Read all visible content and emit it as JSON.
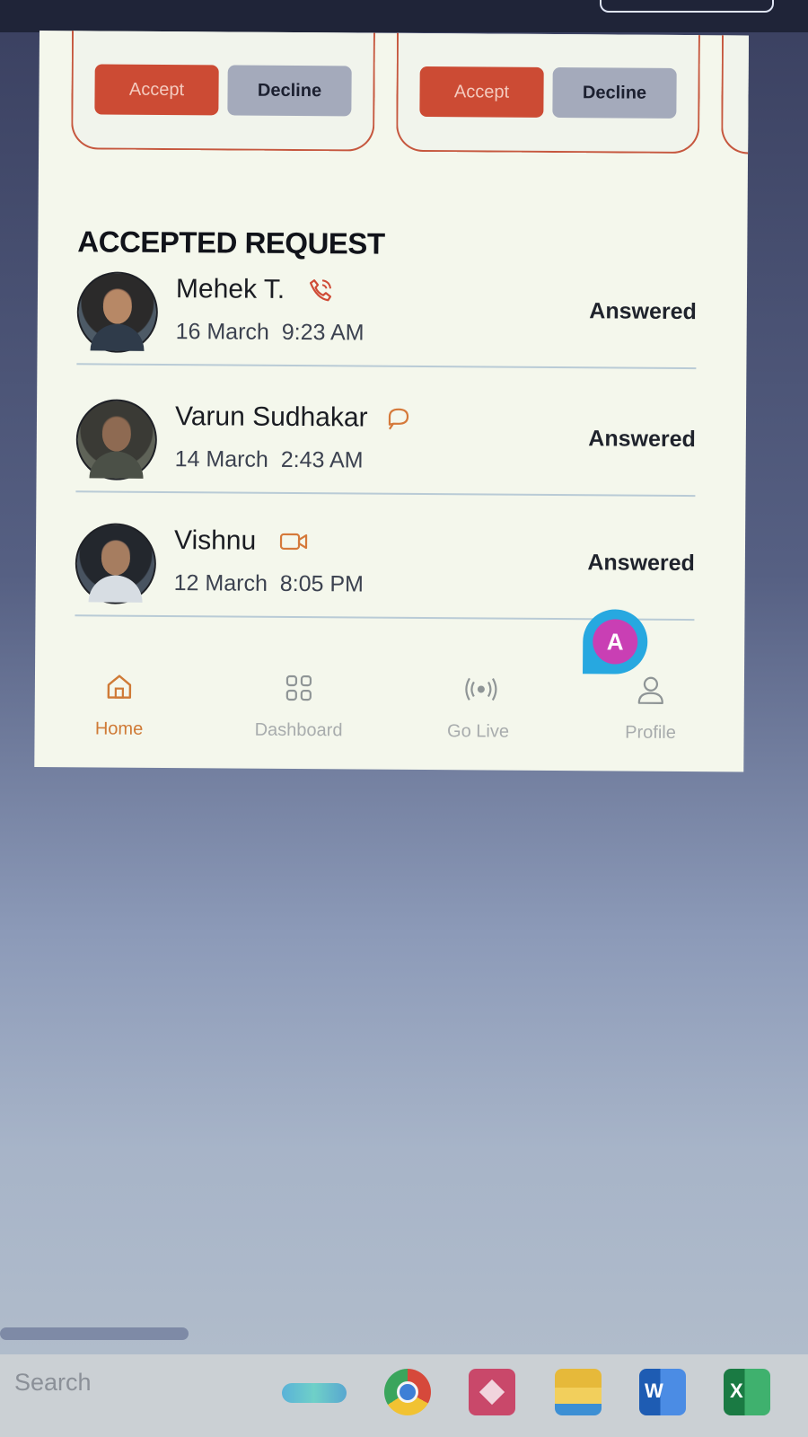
{
  "pending_requests": [
    {
      "accept_label": "Accept",
      "decline_label": "Decline"
    },
    {
      "accept_label": "Accept",
      "decline_label": "Decline"
    }
  ],
  "section_title": "ACCEPTED REQUEST",
  "accepted_requests": [
    {
      "name": "Mehek T.",
      "call_type": "phone-call-icon",
      "date": "16 March",
      "time": "9:23 AM",
      "status": "Answered"
    },
    {
      "name": "Varun Sudhakar",
      "call_type": "chat-bubble-icon",
      "date": "14 March",
      "time": "2:43 AM",
      "status": "Answered"
    },
    {
      "name": "Vishnu",
      "call_type": "video-call-icon",
      "date": "12 March",
      "time": "8:05 PM",
      "status": "Answered"
    }
  ],
  "fab": {
    "initial": "A"
  },
  "nav": [
    {
      "label": "Home",
      "icon": "home-icon"
    },
    {
      "label": "Dashboard",
      "icon": "grid-icon"
    },
    {
      "label": "Go Live",
      "icon": "broadcast-icon"
    },
    {
      "label": "Profile",
      "icon": "user-icon"
    }
  ],
  "taskbar": {
    "search_label": "Search",
    "apps": [
      "copilot-icon",
      "chrome-icon",
      "app-icon",
      "file-explorer-icon",
      "word-icon",
      "excel-icon"
    ]
  },
  "colors": {
    "accent": "#cc4b34",
    "nav_active": "#cf7a36",
    "decline": "#a4aabb",
    "fab_outer": "#27a8e0",
    "fab_inner": "#c93fb4"
  }
}
